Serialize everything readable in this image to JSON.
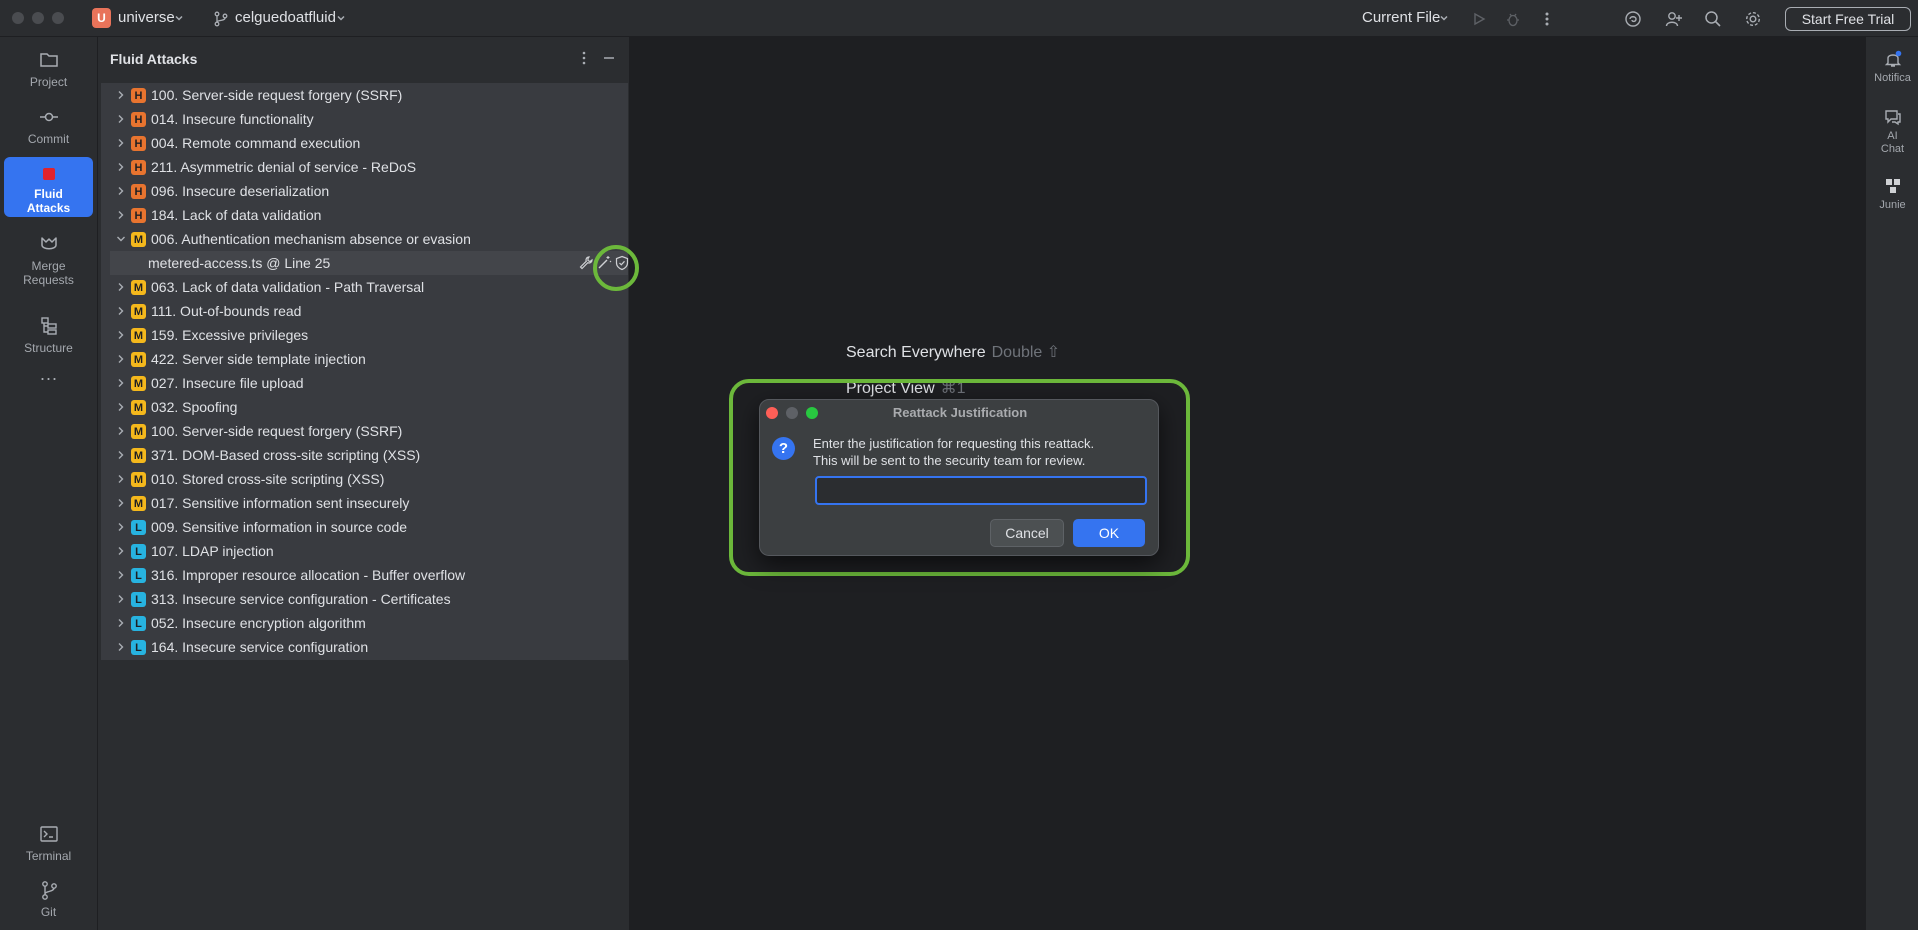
{
  "titlebar": {
    "project_initial": "U",
    "project_name": "universe",
    "branch": "celguedoatfluid",
    "run_config": "Current File",
    "trial_button": "Start Free Trial",
    "icons": [
      "chevron-down-icon",
      "branch-icon",
      "run-icon",
      "debug-icon",
      "more-vertical-icon",
      "ai-assistant-icon",
      "add-user-icon",
      "search-icon",
      "gear-icon"
    ]
  },
  "left_strip": {
    "items": [
      {
        "label": "Project",
        "icon": "folder-icon"
      },
      {
        "label": "Commit",
        "icon": "commit-icon"
      },
      {
        "label": "Fluid Attacks",
        "icon": "fluid-attacks-icon",
        "active": true
      },
      {
        "label": "Merge Requests",
        "icon": "merge-request-icon"
      },
      {
        "label": "Structure",
        "icon": "structure-icon"
      },
      {
        "label": "Terminal",
        "icon": "terminal-icon"
      },
      {
        "label": "Git",
        "icon": "git-icon"
      }
    ],
    "more_label": "···"
  },
  "right_strip": {
    "items": [
      {
        "label": "Notifica",
        "icon": "bell-icon"
      },
      {
        "label": "AI Chat",
        "icon": "ai-chat-icon"
      },
      {
        "label": "Junie",
        "icon": "junie-icon"
      }
    ]
  },
  "panel": {
    "title": "Fluid Attacks",
    "colors": {
      "H": "#e8742f",
      "M": "#f4b81c",
      "L": "#27b3e0"
    },
    "findings": [
      {
        "sev": "H",
        "label": "100. Server-side request forgery (SSRF)"
      },
      {
        "sev": "H",
        "label": "014. Insecure functionality"
      },
      {
        "sev": "H",
        "label": "004. Remote command execution"
      },
      {
        "sev": "H",
        "label": "211. Asymmetric denial of service - ReDoS"
      },
      {
        "sev": "H",
        "label": "096. Insecure deserialization"
      },
      {
        "sev": "H",
        "label": "184. Lack of data validation"
      },
      {
        "sev": "M",
        "label": "006. Authentication mechanism absence or evasion",
        "expanded": true
      },
      {
        "sub": true,
        "label": "metered-access.ts @ Line 25"
      },
      {
        "sev": "M",
        "label": "063. Lack of data validation - Path Traversal"
      },
      {
        "sev": "M",
        "label": "111. Out-of-bounds read"
      },
      {
        "sev": "M",
        "label": "159. Excessive privileges"
      },
      {
        "sev": "M",
        "label": "422. Server side template injection"
      },
      {
        "sev": "M",
        "label": "027. Insecure file upload"
      },
      {
        "sev": "M",
        "label": "032. Spoofing"
      },
      {
        "sev": "M",
        "label": "100. Server-side request forgery (SSRF)"
      },
      {
        "sev": "M",
        "label": "371. DOM-Based cross-site scripting (XSS)"
      },
      {
        "sev": "M",
        "label": "010. Stored cross-site scripting (XSS)"
      },
      {
        "sev": "M",
        "label": "017. Sensitive information sent insecurely"
      },
      {
        "sev": "L",
        "label": "009. Sensitive information in source code"
      },
      {
        "sev": "L",
        "label": "107. LDAP injection"
      },
      {
        "sev": "L",
        "label": "316. Improper resource allocation - Buffer overflow"
      },
      {
        "sev": "L",
        "label": "313. Insecure service configuration - Certificates"
      },
      {
        "sev": "L",
        "label": "052. Insecure encryption algorithm"
      },
      {
        "sev": "L",
        "label": "164. Insecure service configuration"
      }
    ]
  },
  "editor": {
    "hint1": "Search Everywhere",
    "hint1_key": "Double ⇧",
    "hint2": "Project View",
    "hint2_key": "⌘1"
  },
  "dialog": {
    "title": "Reattack Justification",
    "message_line1": "Enter the justification for requesting this reattack.",
    "message_line2": "This will be sent to the security team for review.",
    "input_value": "",
    "cancel_label": "Cancel",
    "ok_label": "OK",
    "icon": "question-icon"
  },
  "highlight_color": "#6cb83b"
}
